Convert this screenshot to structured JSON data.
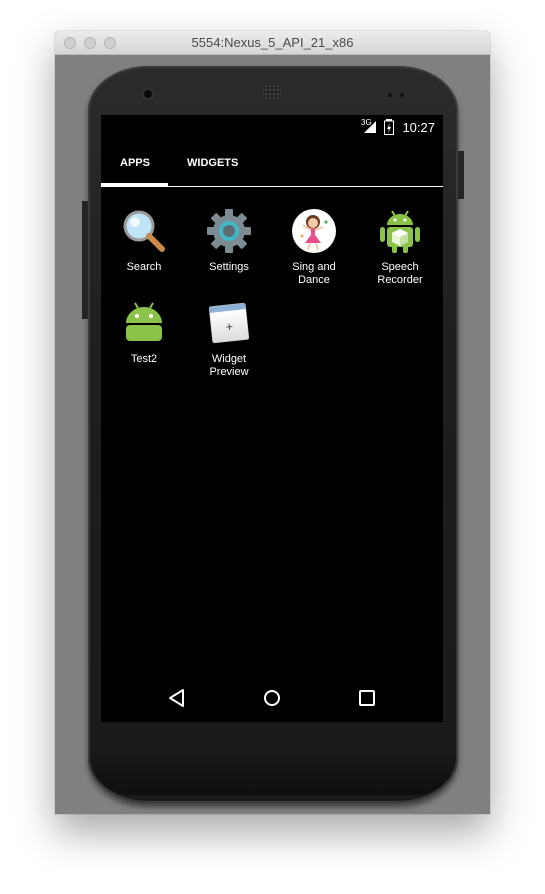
{
  "window": {
    "title": "5554:Nexus_5_API_21_x86"
  },
  "statusbar": {
    "network": "3G",
    "time": "10:27"
  },
  "tabs": [
    {
      "label": "APPS",
      "selected": true
    },
    {
      "label": "WIDGETS",
      "selected": false
    }
  ],
  "apps": [
    {
      "label": "Search",
      "icon": "search-icon"
    },
    {
      "label": "Settings",
      "icon": "settings-gear-icon"
    },
    {
      "label": "Sing and\nDance",
      "icon": "sing-and-dance-icon"
    },
    {
      "label": "Speech\nRecorder",
      "icon": "android-robot-cube-icon"
    },
    {
      "label": "Test2",
      "icon": "android-robot-icon"
    },
    {
      "label": "Widget\nPreview",
      "icon": "widget-preview-icon"
    }
  ],
  "navbar": {
    "back": "back-icon",
    "home": "home-icon",
    "recents": "recents-icon"
  }
}
